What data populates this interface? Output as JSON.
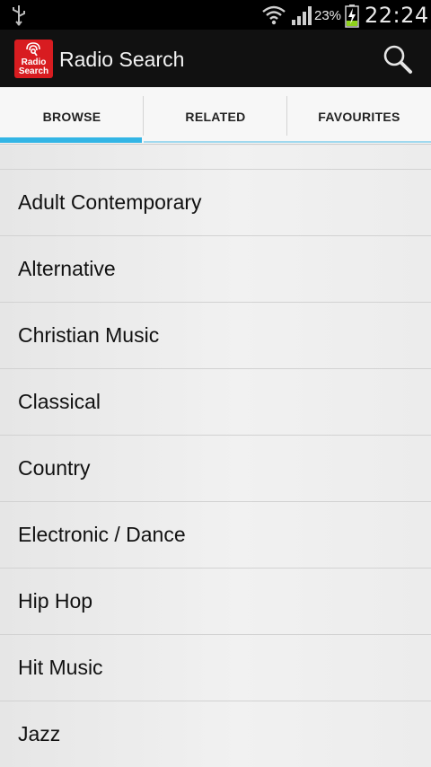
{
  "status_bar": {
    "battery_percent": "23%",
    "time": "22:24",
    "icons": [
      "usb-icon",
      "wifi-icon",
      "signal-icon",
      "battery-charging-icon"
    ]
  },
  "action_bar": {
    "app_icon_line1": "Radio",
    "app_icon_line2": "Search",
    "title": "Radio Search",
    "search_icon": "search-icon"
  },
  "tabs": [
    {
      "label": "BROWSE",
      "selected": true
    },
    {
      "label": "RELATED",
      "selected": false
    },
    {
      "label": "FAVOURITES",
      "selected": false
    }
  ],
  "genres": [
    "Adult Contemporary",
    "Alternative",
    "Christian Music",
    "Classical",
    "Country",
    "Electronic / Dance",
    "Hip Hop",
    "Hit Music",
    "Jazz"
  ],
  "colors": {
    "accent": "#33b5e5",
    "app_icon_bg": "#d81c20",
    "action_bar_bg": "#111111"
  }
}
